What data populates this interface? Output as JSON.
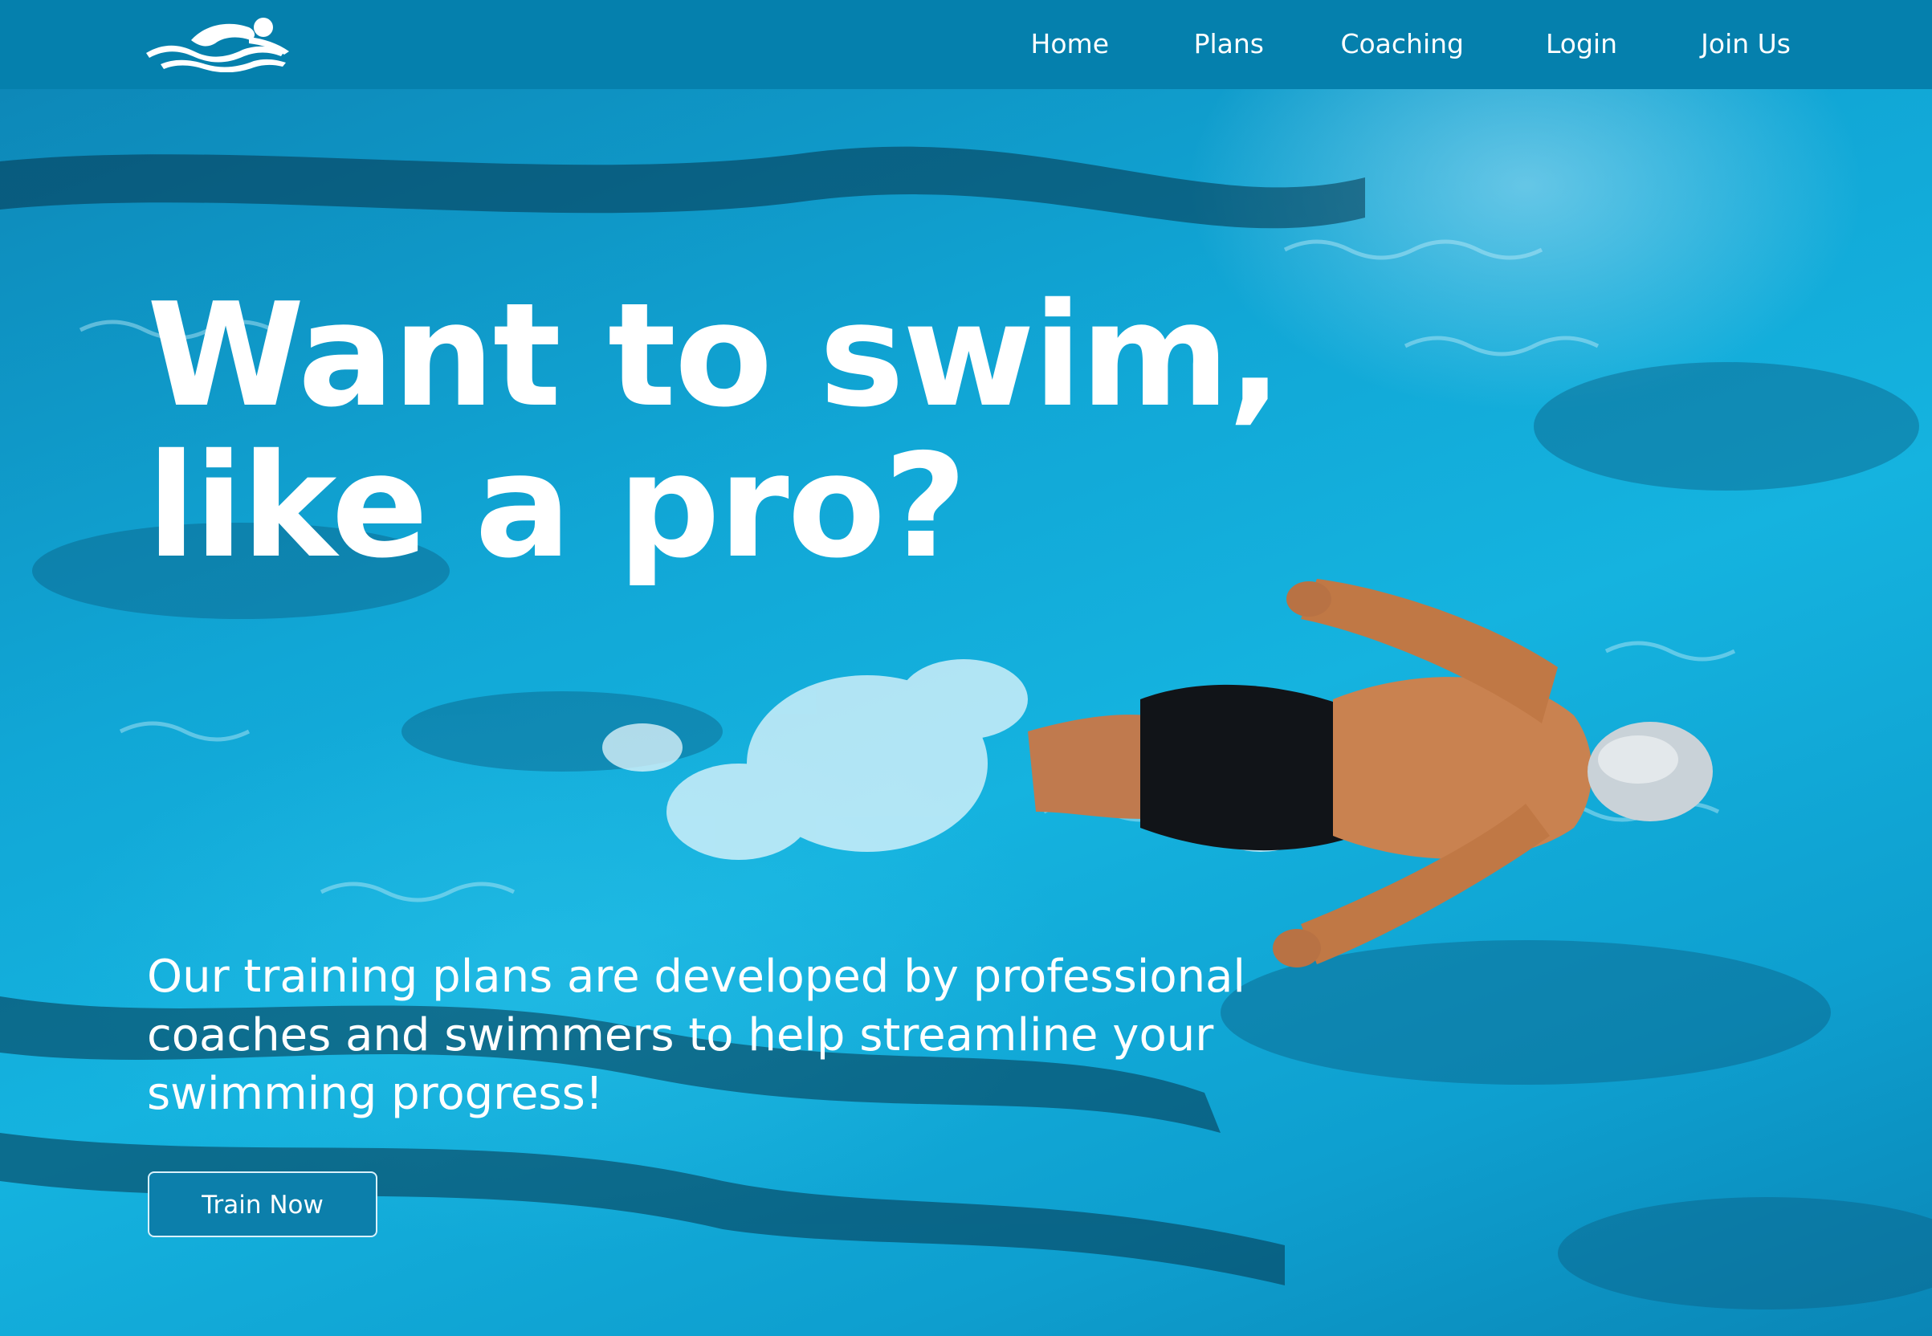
{
  "header": {
    "logo_icon": "swimmer-logo-icon",
    "nav": {
      "home": "Home",
      "plans": "Plans",
      "coaching": "Coaching",
      "login": "Login",
      "join": "Join Us"
    }
  },
  "hero": {
    "headline_line1": "Want to swim,",
    "headline_line2": "like a pro?",
    "subtext": "Our training plans are developed by professional coaches and swimmers to help streamline your swimming progress!",
    "cta_label": "Train Now",
    "image": "swimmer-butterfly-stroke-photo"
  },
  "colors": {
    "header_bg": "#0580ad",
    "water": "#11a7d6",
    "text": "#ffffff",
    "button_bg": "#0c7fab"
  }
}
